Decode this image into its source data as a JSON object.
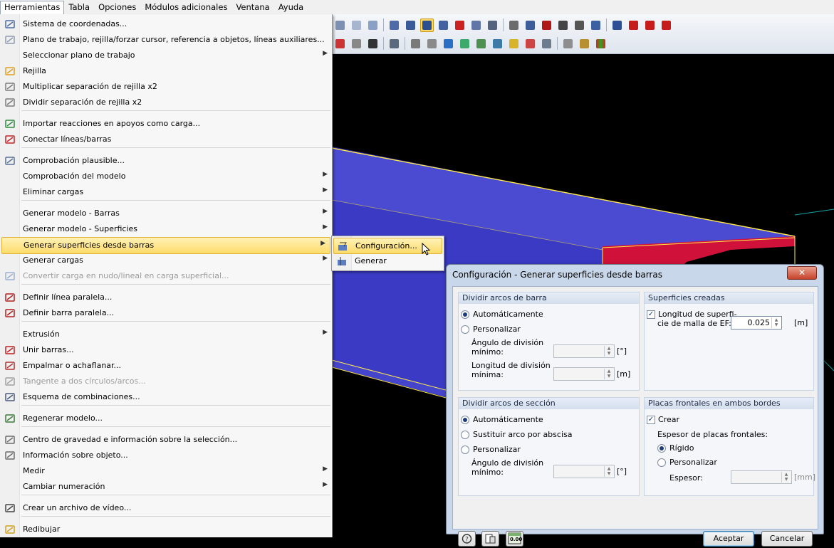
{
  "menubar": {
    "items": [
      "Herramientas",
      "Tabla",
      "Opciones",
      "Módulos adicionales",
      "Ventana",
      "Ayuda"
    ]
  },
  "menu": {
    "items": [
      {
        "label": "Sistema de coordenadas...",
        "icon": "coordinate-system-icon",
        "submenu": false,
        "disabled": false
      },
      {
        "label": "Plano de trabajo, rejilla/forzar cursor, referencia a objetos, líneas auxiliares...",
        "icon": "work-plane-icon",
        "submenu": false,
        "disabled": false
      },
      {
        "label": "Seleccionar plano de trabajo",
        "icon": "",
        "submenu": true,
        "disabled": false
      },
      {
        "label": "Rejilla",
        "icon": "grid-icon",
        "submenu": false,
        "disabled": false
      },
      {
        "label": "Multiplicar separación de rejilla x2",
        "icon": "grid-multiply-icon",
        "submenu": false,
        "disabled": false
      },
      {
        "label": "Dividir separación de rejilla x2",
        "icon": "grid-divide-icon",
        "submenu": false,
        "disabled": false
      },
      {
        "label": "Importar reacciones en apoyos como carga...",
        "icon": "import-reactions-icon",
        "submenu": false,
        "disabled": false
      },
      {
        "label": "Conectar líneas/barras",
        "icon": "connect-lines-icon",
        "submenu": false,
        "disabled": false
      },
      {
        "label": "Comprobación plausible...",
        "icon": "plausibility-check-icon",
        "submenu": false,
        "disabled": false
      },
      {
        "label": "Comprobación del modelo",
        "icon": "",
        "submenu": true,
        "disabled": false
      },
      {
        "label": "Eliminar cargas",
        "icon": "",
        "submenu": true,
        "disabled": false
      },
      {
        "label": "Generar modelo - Barras",
        "icon": "",
        "submenu": true,
        "disabled": false
      },
      {
        "label": "Generar modelo - Superficies",
        "icon": "",
        "submenu": true,
        "disabled": false
      },
      {
        "label": "Generar superficies desde barras",
        "icon": "",
        "submenu": true,
        "disabled": false
      },
      {
        "label": "Generar cargas",
        "icon": "",
        "submenu": true,
        "disabled": false
      },
      {
        "label": "Convertir carga en nudo/lineal en carga superficial...",
        "icon": "convert-load-icon",
        "submenu": false,
        "disabled": true
      },
      {
        "label": "Definir línea paralela...",
        "icon": "parallel-line-icon",
        "submenu": false,
        "disabled": false
      },
      {
        "label": "Definir barra paralela...",
        "icon": "parallel-member-icon",
        "submenu": false,
        "disabled": false
      },
      {
        "label": "Extrusión",
        "icon": "",
        "submenu": true,
        "disabled": false
      },
      {
        "label": "Unir barras...",
        "icon": "join-members-icon",
        "submenu": false,
        "disabled": false
      },
      {
        "label": "Empalmar o achaflanar...",
        "icon": "fillet-icon",
        "submenu": false,
        "disabled": false
      },
      {
        "label": "Tangente a dos círculos/arcos...",
        "icon": "tangent-icon",
        "submenu": false,
        "disabled": true
      },
      {
        "label": "Esquema de combinaciones...",
        "icon": "combination-scheme-icon",
        "submenu": false,
        "disabled": false
      },
      {
        "label": "Regenerar modelo...",
        "icon": "regenerate-model-icon",
        "submenu": false,
        "disabled": false
      },
      {
        "label": "Centro de gravedad e información sobre la selección...",
        "icon": "center-of-gravity-icon",
        "submenu": false,
        "disabled": false
      },
      {
        "label": "Información sobre objeto...",
        "icon": "object-info-icon",
        "submenu": false,
        "disabled": false
      },
      {
        "label": "Medir",
        "icon": "",
        "submenu": true,
        "disabled": false
      },
      {
        "label": "Cambiar numeración",
        "icon": "",
        "submenu": true,
        "disabled": false
      },
      {
        "label": "Crear un archivo de vídeo...",
        "icon": "video-icon",
        "submenu": false,
        "disabled": false
      },
      {
        "label": "Redibujar",
        "icon": "redraw-icon",
        "submenu": false,
        "disabled": false
      }
    ]
  },
  "submenu": {
    "items": [
      {
        "label": "Configuración...",
        "icon": "settings-icon"
      },
      {
        "label": "Generar",
        "icon": "generate-icon"
      }
    ]
  },
  "dialog": {
    "title": "Configuración - Generar superficies desde barras",
    "close_glyph": "✕",
    "group_bar_arcs": {
      "title": "Dividir arcos de barra",
      "auto": "Automáticamente",
      "custom": "Personalizar",
      "min_angle_1": "Ángulo de división",
      "min_angle_2": "mínimo:",
      "min_angle_unit": "[°]",
      "min_length_1": "Longitud de división",
      "min_length_2": "mínima:",
      "min_length_unit": "[m]"
    },
    "group_surfaces": {
      "title": "Superficies creadas",
      "mesh_label_1": "Longitud de superfi-",
      "mesh_label_2": "cie de malla de EF:",
      "mesh_value": "0.025",
      "mesh_unit": "[m]"
    },
    "group_section_arcs": {
      "title": "Dividir arcos de sección",
      "auto": "Automáticamente",
      "replace": "Sustituir arco por abscisa",
      "custom": "Personalizar",
      "min_angle_1": "Ángulo de división",
      "min_angle_2": "mínimo:",
      "min_angle_unit": "[°]"
    },
    "group_end_plates": {
      "title": "Placas frontales en ambos bordes",
      "create": "Crear",
      "thickness_title": "Espesor de placas frontales:",
      "rigid": "Rígido",
      "custom": "Personalizar",
      "thickness_label": "Espesor:",
      "thickness_unit": "[mm]"
    },
    "ok": "Aceptar",
    "cancel": "Cancelar",
    "units_button_text": "0.00"
  },
  "colors": {
    "beam_top": "#4b4bd2",
    "beam_side": "#3737b8",
    "beam_end": "#d0123a",
    "beam_edge": "#ffe94a",
    "highlight": "#fddb6b"
  }
}
